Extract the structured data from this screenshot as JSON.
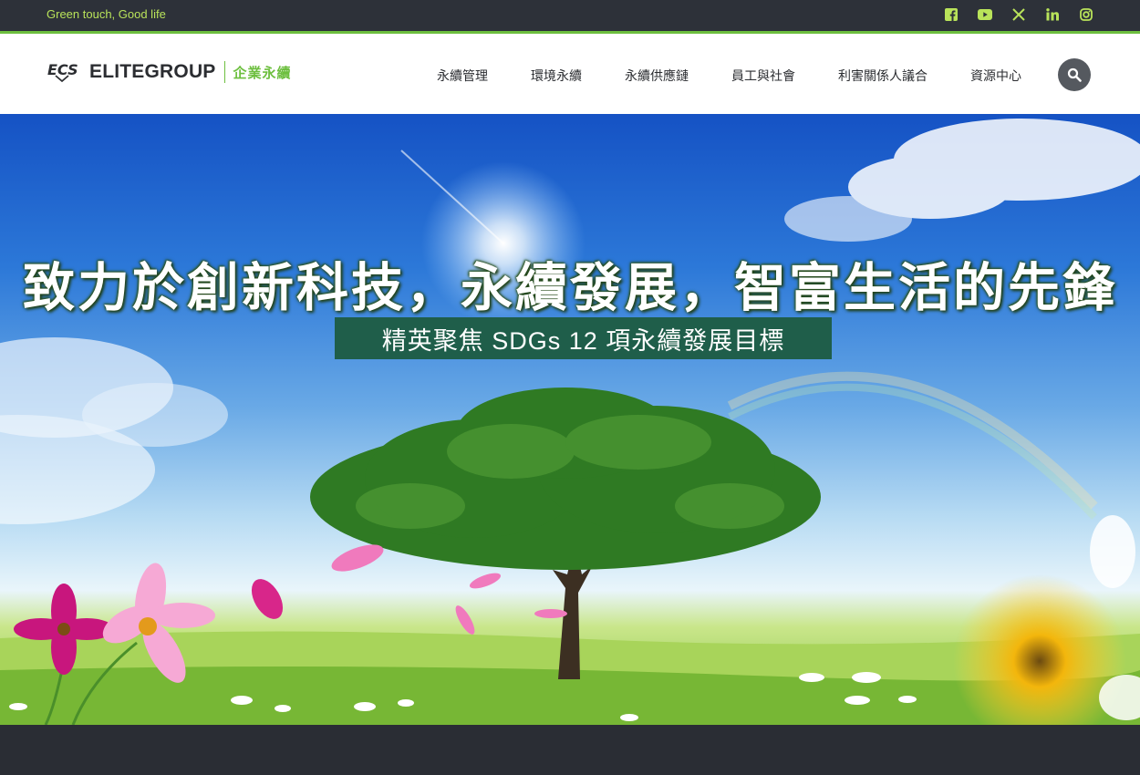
{
  "topbar": {
    "tagline": "Green touch, Good life",
    "social_icons": [
      "facebook-icon",
      "youtube-icon",
      "x-icon",
      "linkedin-icon",
      "instagram-icon"
    ],
    "accent": "#6dbf3f"
  },
  "header": {
    "brand": "ELITEGROUP",
    "section": "企業永續",
    "nav": [
      "永續管理",
      "環境永續",
      "永續供應鏈",
      "員工與社會",
      "利害關係人議合",
      "資源中心"
    ],
    "search_icon": "search-icon"
  },
  "hero": {
    "headline": "致力於創新科技，永續發展，智富生活的先鋒",
    "subtitle": "精英聚焦 SDGs 12 項永續發展目標"
  }
}
